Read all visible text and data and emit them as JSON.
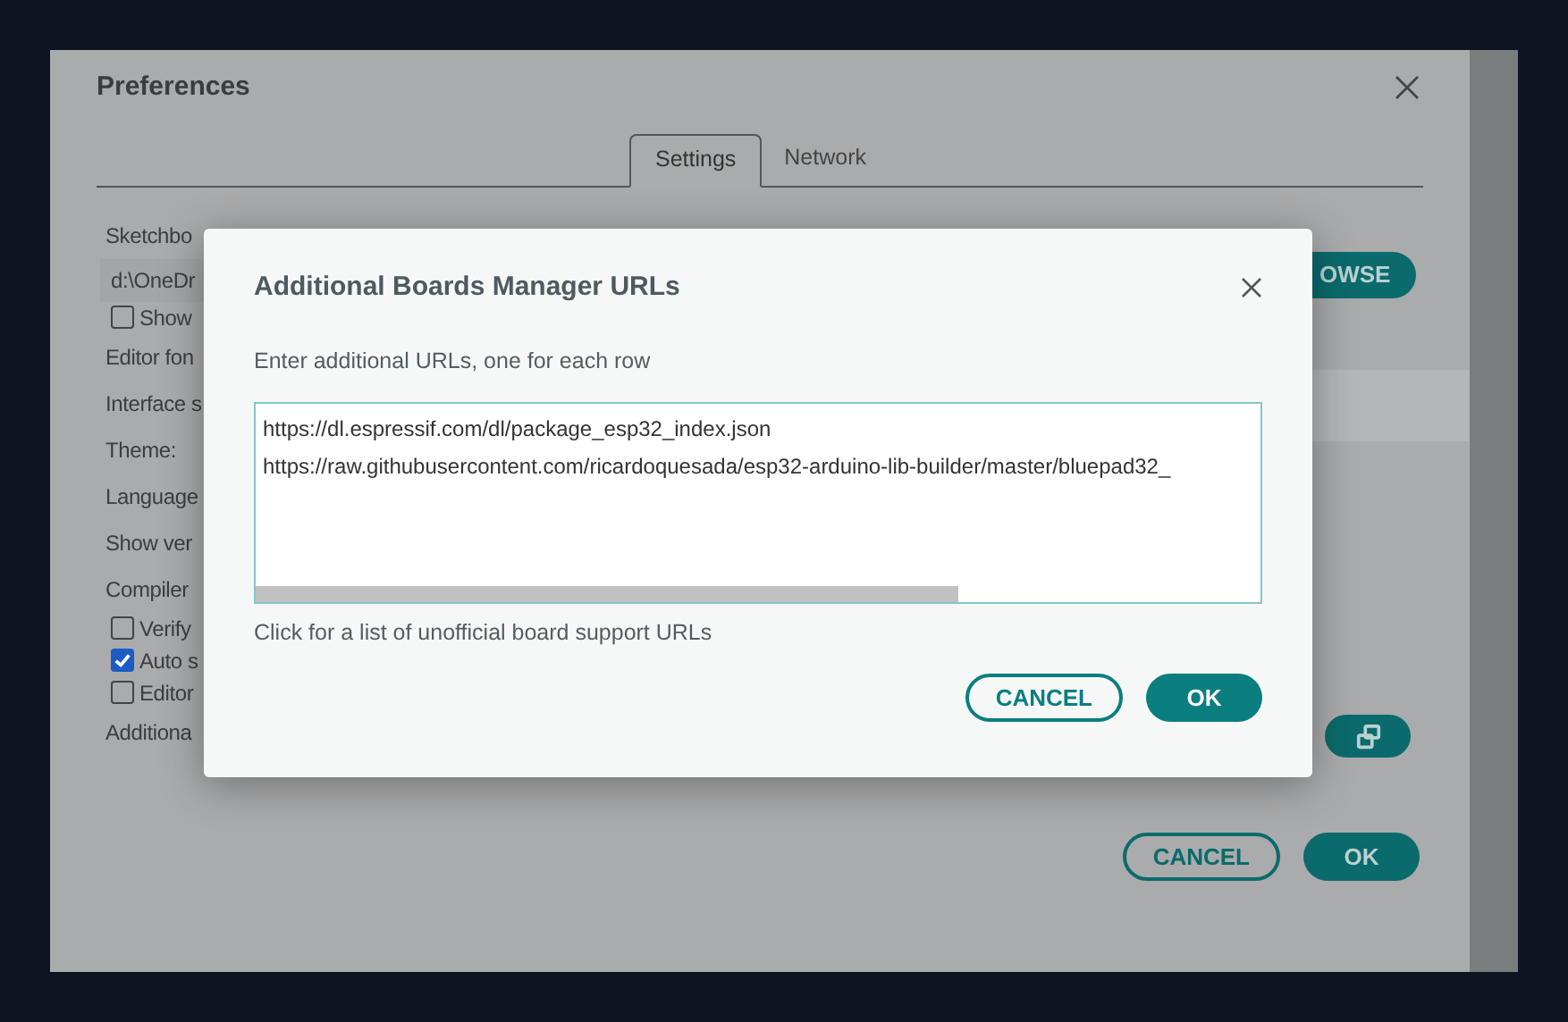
{
  "window": {
    "title": "Preferences"
  },
  "tabs": [
    {
      "label": "Settings",
      "selected": true
    },
    {
      "label": "Network",
      "selected": false
    }
  ],
  "settings": [
    {
      "kind": "label",
      "text": "Sketchbo"
    },
    {
      "kind": "path",
      "text": "d:\\OneDr"
    },
    {
      "kind": "checkbox",
      "text": "Show",
      "checked": false
    },
    {
      "kind": "label",
      "text": "Editor fon"
    },
    {
      "kind": "label",
      "text": "Interface s"
    },
    {
      "kind": "label",
      "text": "Theme:"
    },
    {
      "kind": "label",
      "text": "Language"
    },
    {
      "kind": "label",
      "text": "Show ver"
    },
    {
      "kind": "label",
      "text": "Compiler"
    },
    {
      "kind": "checkbox",
      "text": "Verify",
      "checked": false
    },
    {
      "kind": "checkbox",
      "text": "Auto s",
      "checked": true
    },
    {
      "kind": "checkbox",
      "text": "Editor",
      "checked": false
    },
    {
      "kind": "label",
      "text": "Additiona"
    }
  ],
  "browse_button": "OWSE",
  "buttons": [
    "CANCEL",
    "OK"
  ],
  "dialog": {
    "title": "Additional Boards Manager URLs",
    "description": "Enter additional URLs, one for each row",
    "urls": [
      "https://dl.espressif.com/dl/package_esp32_index.json",
      "https://raw.githubusercontent.com/ricardoquesada/esp32-arduino-lib-builder/master/bluepad32_"
    ],
    "link": "Click for a list of unofficial board support URLs",
    "buttons": [
      "CANCEL",
      "OK"
    ]
  }
}
